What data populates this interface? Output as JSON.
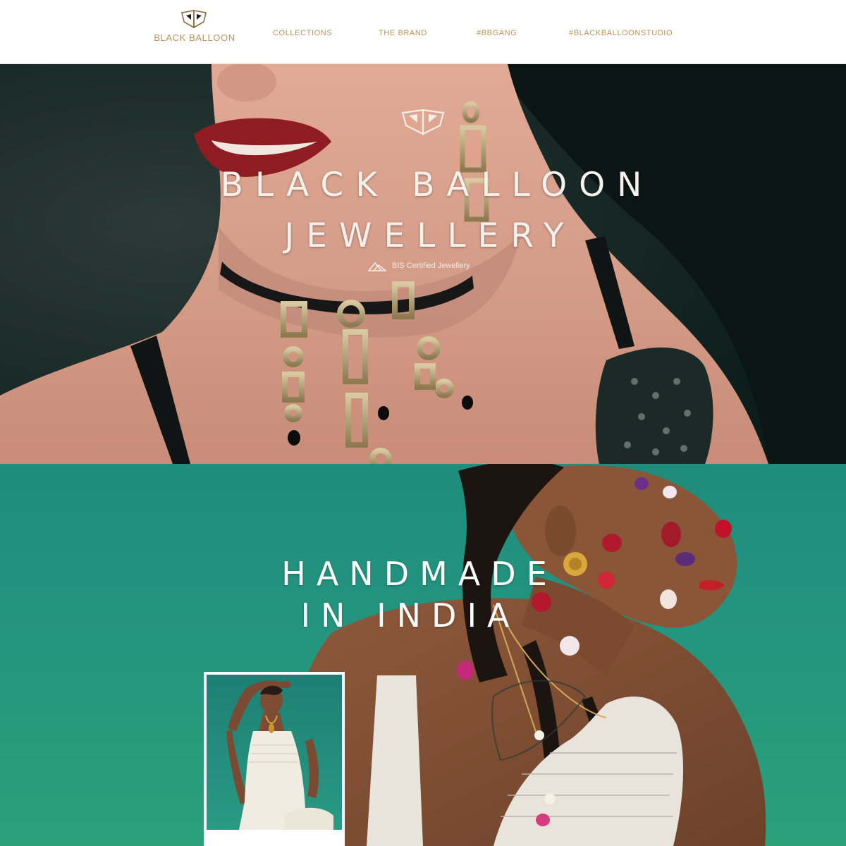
{
  "header": {
    "logo_text": "BLACK BALLOON",
    "nav": [
      {
        "label": "COLLECTIONS"
      },
      {
        "label": "THE BRAND"
      },
      {
        "label": "#BBGANG"
      },
      {
        "label": "#BLACKBALLOONSTUDIO"
      }
    ]
  },
  "hero1": {
    "title_line1": "BLACK BALLOON",
    "title_line2": "JEWELLERY",
    "certification": "BIS Certified Jewellery"
  },
  "hero2": {
    "title_line1": "HANDMADE",
    "title_line2": "IN INDIA"
  },
  "icons": {
    "logo": "balloon-logo-icon",
    "hero_emblem": "balloon-emblem-icon",
    "bis": "bis-hallmark-icon"
  },
  "colors": {
    "brand_gold": "#b99458",
    "hero1_dark_green": "#0f2623",
    "hero2_teal": "#24957f",
    "title_white": "#f4f1ec"
  }
}
